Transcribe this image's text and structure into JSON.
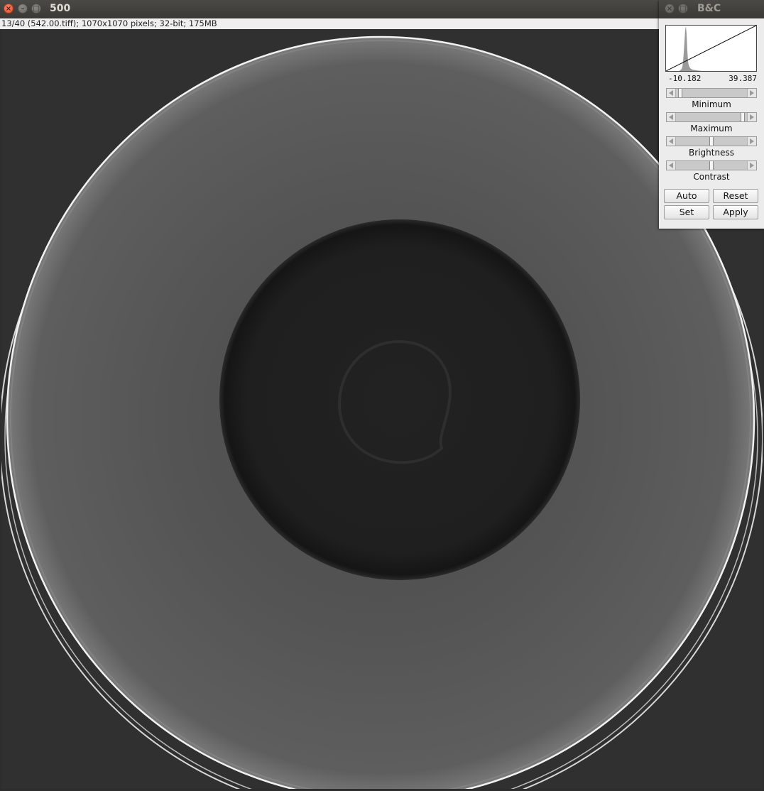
{
  "image_window": {
    "title": "500",
    "info": "13/40 (542.00.tiff); 1070x1070 pixels; 32-bit; 175MB",
    "window_buttons": {
      "close": "×",
      "minimize": "–",
      "maximize": "□"
    }
  },
  "bc_panel": {
    "title": "B&C",
    "window_buttons": {
      "close": "×",
      "maximize": "□"
    },
    "histogram": {
      "min_label": "-10.182",
      "max_label": "39.387"
    },
    "sliders": {
      "minimum": {
        "label": "Minimum",
        "position": 0.03
      },
      "maximum": {
        "label": "Maximum",
        "position": 0.97
      },
      "brightness": {
        "label": "Brightness",
        "position": 0.5
      },
      "contrast": {
        "label": "Contrast",
        "position": 0.5
      }
    },
    "buttons": {
      "auto": "Auto",
      "reset": "Reset",
      "set": "Set",
      "apply": "Apply"
    }
  },
  "colors": {
    "image_background": "#303030",
    "outer_disc": "#5a5a5a",
    "inner_disc": "#1e1e1e",
    "ring_highlight": "#f0f0f0"
  }
}
